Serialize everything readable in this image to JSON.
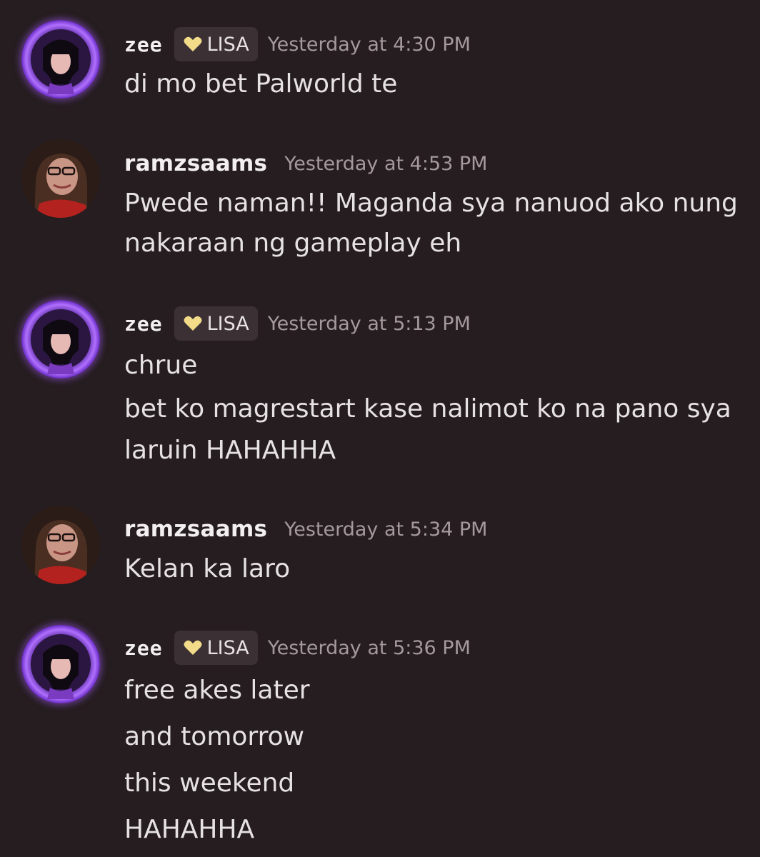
{
  "messages": [
    {
      "author": "zee",
      "role_tag": "LISA",
      "timestamp": "Yesterday at 4:30 PM",
      "lines": [
        "di mo bet Palworld te"
      ]
    },
    {
      "author": "ramzsaams",
      "timestamp": "Yesterday at 4:53 PM",
      "lines": [
        "Pwede naman!! Maganda sya nanuod ako nung",
        "nakaraan ng gameplay eh"
      ]
    },
    {
      "author": "zee",
      "role_tag": "LISA",
      "timestamp": "Yesterday at 5:13 PM",
      "lines": [
        "chrue",
        "bet ko magrestart kase nalimot ko na pano sya",
        "laruin HAHAHHA"
      ]
    },
    {
      "author": "ramzsaams",
      "timestamp": "Yesterday at 5:34 PM",
      "lines": [
        "Kelan ka laro"
      ]
    },
    {
      "author": "zee",
      "role_tag": "LISA",
      "timestamp": "Yesterday at 5:36 PM",
      "lines": [
        "free akes later",
        "and tomorrow",
        "this weekend",
        "HAHAHHA"
      ]
    }
  ],
  "icons": {
    "role_tag_icon": "heart-icon",
    "role_tag_icon_color": "#f2dc8a",
    "zee_avatar_glow": "#a259ff",
    "background": "#251d1f"
  }
}
